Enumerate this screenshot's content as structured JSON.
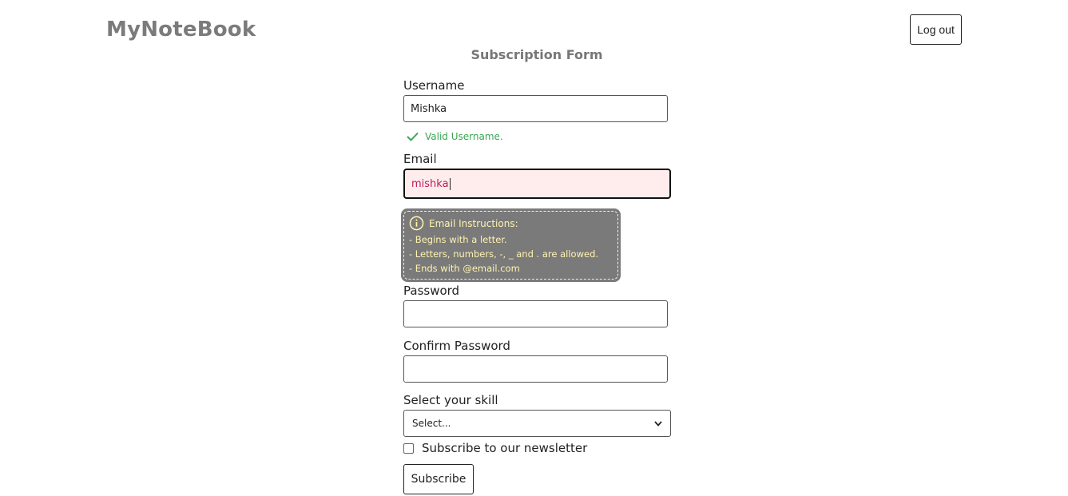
{
  "header": {
    "logo": "MyNoteBook",
    "logout_label": "Log out"
  },
  "form": {
    "title": "Subscription Form",
    "username": {
      "label": "Username",
      "value": "Mishka",
      "valid_message": "Valid Username."
    },
    "email": {
      "label": "Email",
      "value": "mishka"
    },
    "email_instructions": {
      "heading": "Email Instructions:",
      "lines": [
        "- Begins with a letter.",
        "- Letters, numbers, -, _ and . are allowed.",
        "- Ends with @email.com"
      ]
    },
    "password": {
      "label": "Password",
      "value": ""
    },
    "confirm_password": {
      "label": "Confirm Password",
      "value": ""
    },
    "skill": {
      "label": "Select your skill",
      "selected": "Select..."
    },
    "newsletter": {
      "label": "Subscribe to our newsletter",
      "checked": false
    },
    "submit_label": "Subscribe"
  },
  "colors": {
    "valid": "#3aa552",
    "invalid_bg": "#ffeded",
    "invalid_text": "#c2185b",
    "instructions_bg": "#7a7a7a",
    "instructions_text": "#fff3b0"
  }
}
